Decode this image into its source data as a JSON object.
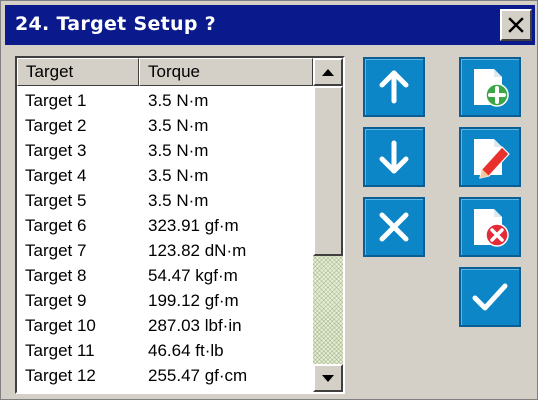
{
  "window": {
    "title": "24. Target Setup ?",
    "close_glyph": "×"
  },
  "list": {
    "columns": [
      "Target",
      "Torque"
    ],
    "rows": [
      {
        "target": "Target 1",
        "torque": "3.5 N·m"
      },
      {
        "target": "Target 2",
        "torque": "3.5 N·m"
      },
      {
        "target": "Target 3",
        "torque": "3.5 N·m"
      },
      {
        "target": "Target 4",
        "torque": "3.5 N·m"
      },
      {
        "target": "Target 5",
        "torque": "3.5 N·m"
      },
      {
        "target": "Target 6",
        "torque": "323.91 gf·m"
      },
      {
        "target": "Target 7",
        "torque": "123.82 dN·m"
      },
      {
        "target": "Target 8",
        "torque": "54.47 kgf·m"
      },
      {
        "target": "Target 9",
        "torque": "199.12 gf·m"
      },
      {
        "target": "Target 10",
        "torque": "287.03 lbf·in"
      },
      {
        "target": "Target 11",
        "torque": "46.64 ft·lb"
      },
      {
        "target": "Target 12",
        "torque": "255.47 gf·cm"
      }
    ]
  },
  "toolbar": {
    "buttons": [
      {
        "name": "move-up-button",
        "icon": "arrow-up-icon"
      },
      {
        "name": "add-target-button",
        "icon": "add-document-icon"
      },
      {
        "name": "move-down-button",
        "icon": "arrow-down-icon"
      },
      {
        "name": "edit-target-button",
        "icon": "edit-document-icon"
      },
      {
        "name": "cancel-button",
        "icon": "close-icon"
      },
      {
        "name": "delete-target-button",
        "icon": "delete-document-icon"
      },
      {
        "name": "confirm-button",
        "icon": "checkmark-icon"
      }
    ]
  },
  "colors": {
    "title_bar": "#0a1a8c",
    "button_fill": "#0d86c8",
    "add_badge": "#3aa648",
    "delete_badge": "#e32b3a",
    "pencil": "#e8302c"
  }
}
